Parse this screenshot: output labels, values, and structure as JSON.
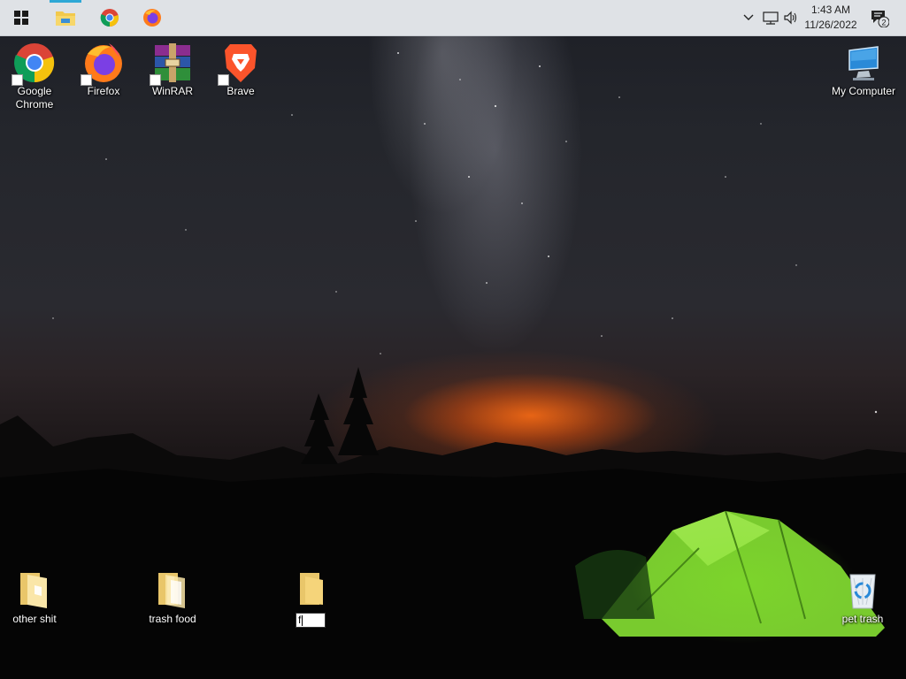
{
  "taskbar": {
    "pinned": [
      {
        "name": "file-explorer",
        "active": true
      },
      {
        "name": "google-chrome",
        "active": false
      },
      {
        "name": "firefox",
        "active": false
      }
    ]
  },
  "tray": {
    "time": "1:43 AM",
    "date": "11/26/2022",
    "notification_count": "2"
  },
  "desktop": {
    "top_icons": [
      {
        "label": "Google Chrome",
        "icon": "chrome-icon",
        "shortcut": true
      },
      {
        "label": "Firefox",
        "icon": "firefox-icon",
        "shortcut": true
      },
      {
        "label": "WinRAR",
        "icon": "winrar-icon",
        "shortcut": true
      },
      {
        "label": "Brave",
        "icon": "brave-icon",
        "shortcut": true
      },
      {
        "label": "My Computer",
        "icon": "computer-icon",
        "shortcut": false
      }
    ],
    "bottom_icons": [
      {
        "label": "other shit",
        "icon": "folder-icon"
      },
      {
        "label": "trash food",
        "icon": "folder-icon"
      },
      {
        "label": "f",
        "icon": "folder-icon",
        "renaming": true
      },
      {
        "label": "pet trash",
        "icon": "recycle-bin-icon"
      }
    ]
  },
  "colors": {
    "taskbar_bg": "#dfe2e6",
    "taskbar_active_indicator": "#2ea8d6",
    "folder_yellow": "#f5d47a",
    "tent_green": "#8ee03a",
    "horizon_orange": "#ff6e14"
  }
}
